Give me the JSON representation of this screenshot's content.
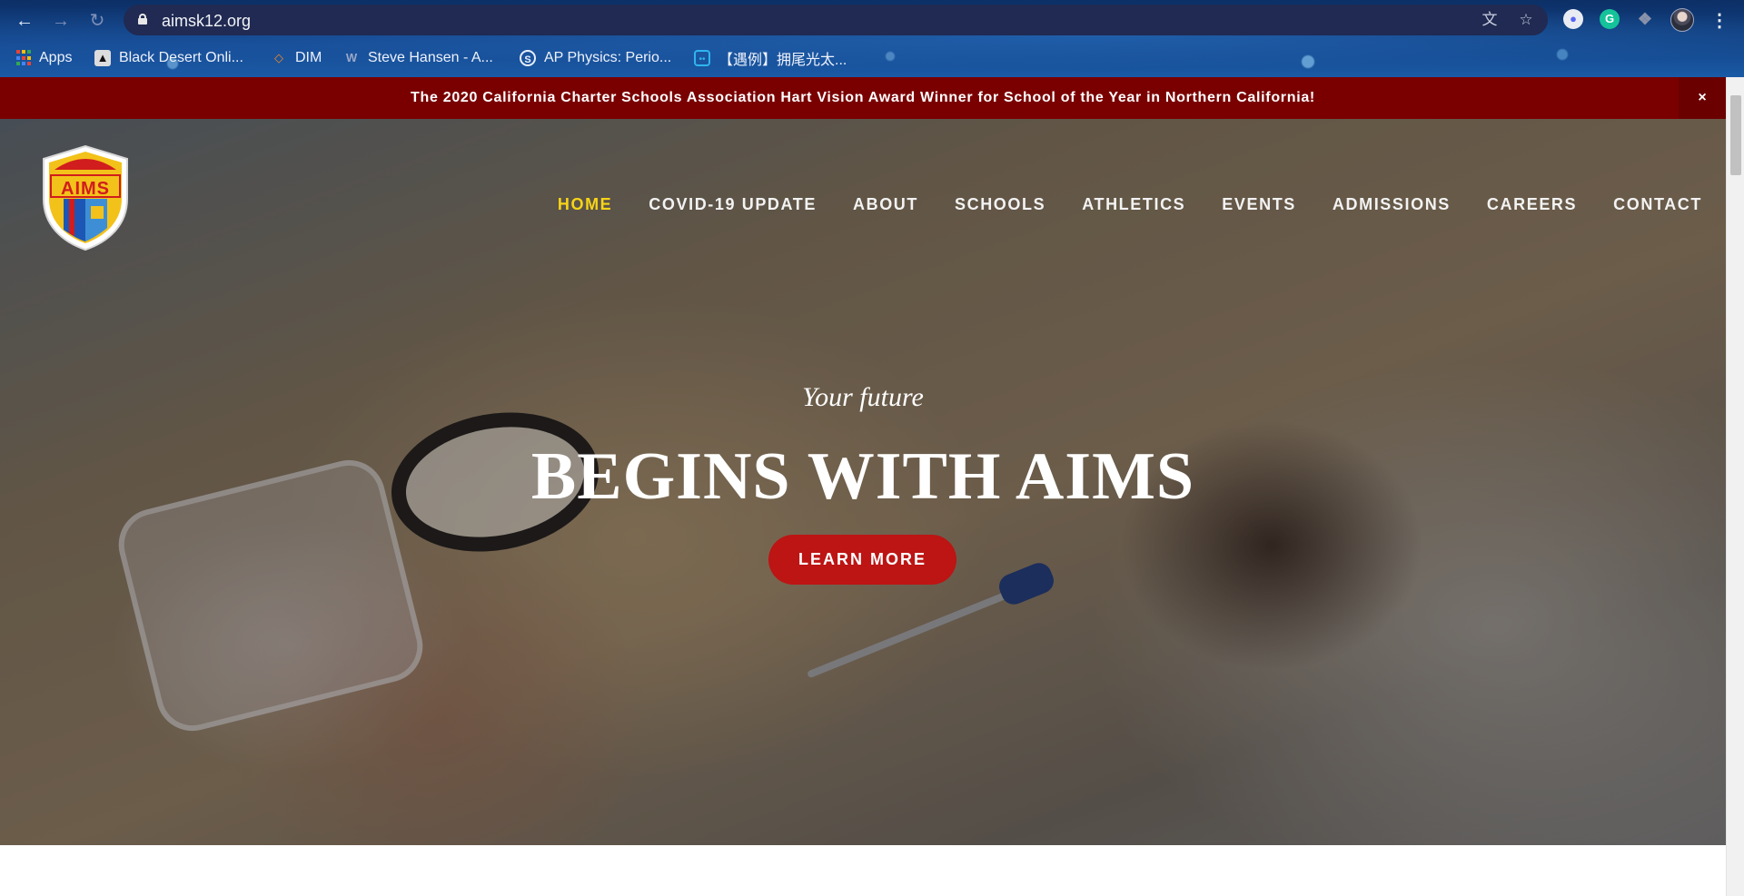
{
  "browser": {
    "url": "aimsk12.org",
    "nav_icons": [
      "back-arrow-icon",
      "forward-arrow-icon",
      "reload-icon"
    ],
    "omnibox_icons": [
      "translate-icon",
      "bookmark-star-icon"
    ],
    "extensions": [
      "discord-icon",
      "grammarly-icon",
      "extensions-puzzle-icon"
    ],
    "bookmarks": [
      {
        "label": "Apps",
        "icon": "apps-grid-icon"
      },
      {
        "label": "Black Desert Onli...",
        "icon": "black-desert-icon"
      },
      {
        "label": "DIM",
        "icon": "dim-icon"
      },
      {
        "label": "Steve Hansen - A...",
        "icon": "wordpress-icon"
      },
      {
        "label": "AP Physics: Perio...",
        "icon": "schoology-icon"
      },
      {
        "label": "【遇例】拥尾光太...",
        "icon": "bilibili-icon"
      }
    ]
  },
  "banner": {
    "text": "The 2020 California Charter Schools Association Hart Vision Award Winner for School of the Year in Northern California!",
    "close": "×"
  },
  "logo": {
    "text": "AIMS"
  },
  "nav": {
    "items": [
      "HOME",
      "COVID-19 UPDATE",
      "ABOUT",
      "SCHOOLS",
      "ATHLETICS",
      "EVENTS",
      "ADMISSIONS",
      "CAREERS",
      "CONTACT"
    ],
    "active": "HOME"
  },
  "hero": {
    "kicker": "Your future",
    "title": "BEGINS WITH AIMS",
    "cta": "LEARN MORE"
  },
  "colors": {
    "banner": "#7a0000",
    "active_nav": "#f7d417",
    "cta": "#bd1414"
  }
}
